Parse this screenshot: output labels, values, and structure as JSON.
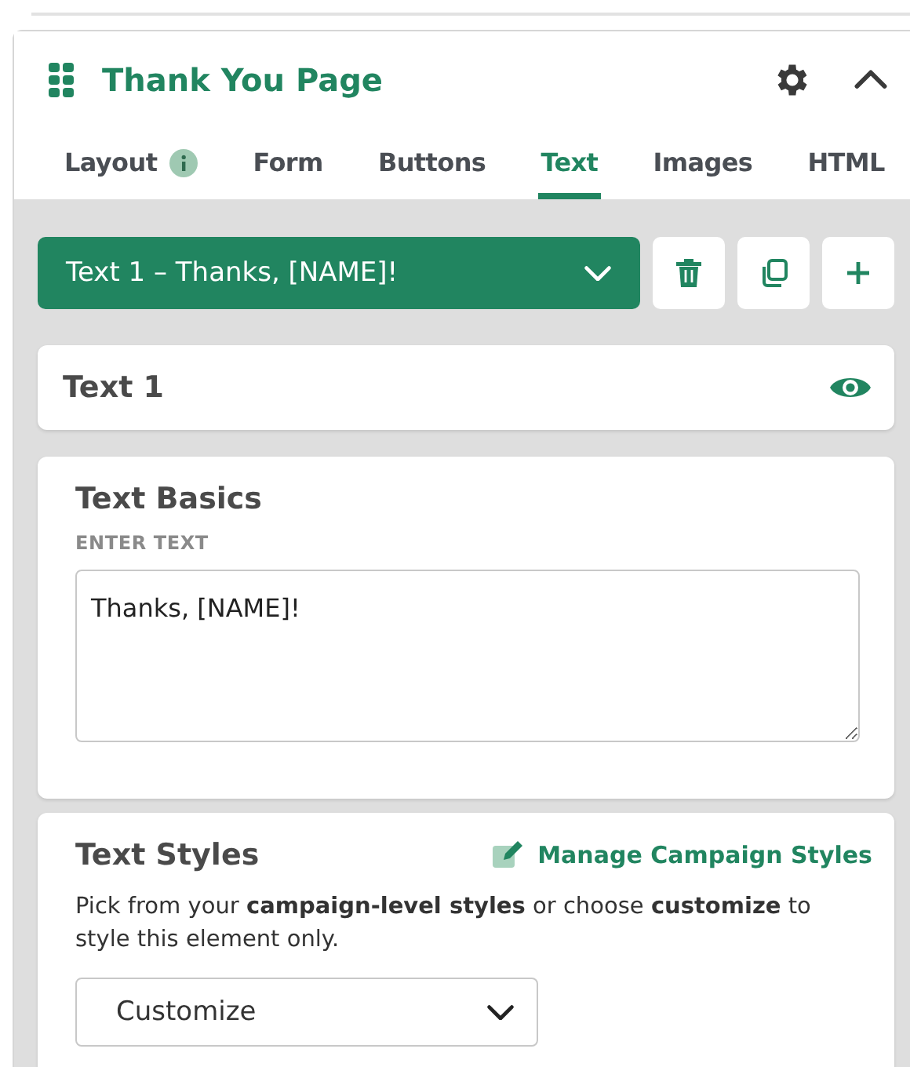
{
  "header": {
    "title": "Thank You Page"
  },
  "tabs": [
    {
      "label": "Layout",
      "info": true,
      "selected": false
    },
    {
      "label": "Form",
      "info": false,
      "selected": false
    },
    {
      "label": "Buttons",
      "info": false,
      "selected": false
    },
    {
      "label": "Text",
      "info": false,
      "selected": true
    },
    {
      "label": "Images",
      "info": false,
      "selected": false
    },
    {
      "label": "HTML",
      "info": false,
      "selected": false
    }
  ],
  "element_select": {
    "value": "Text 1 – Thanks, [NAME]!"
  },
  "element_card": {
    "title": "Text 1",
    "visible": true
  },
  "text_basics": {
    "title": "Text Basics",
    "field_label": "ENTER TEXT",
    "value": "Thanks, [NAME]!"
  },
  "text_styles": {
    "title": "Text Styles",
    "link": "Manage Campaign Styles",
    "description": "Pick from your **campaign-level styles** or choose **customize** to style this element only.",
    "style_select": "Customize"
  }
}
